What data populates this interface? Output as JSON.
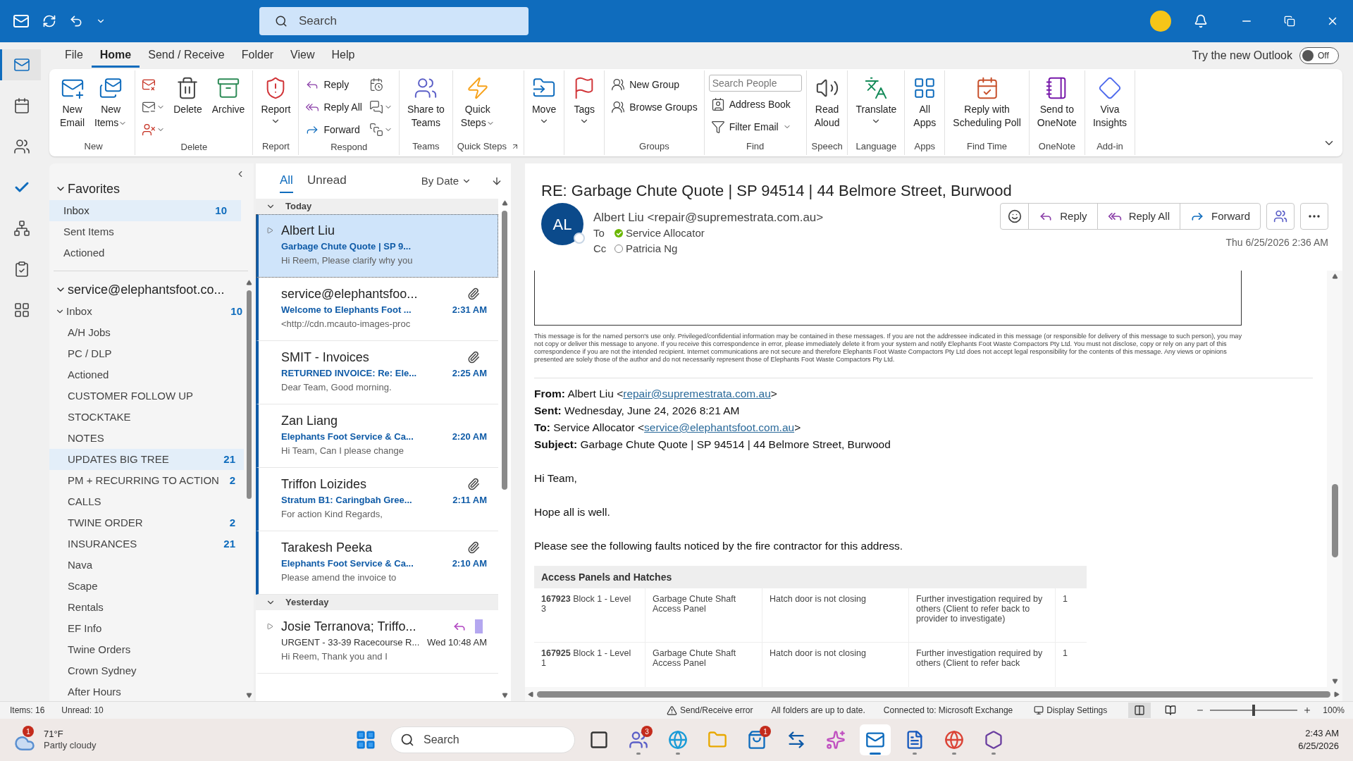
{
  "title_bar": {
    "search": {
      "placeholder": "Search"
    }
  },
  "app_rail": [
    {
      "selected": true
    },
    {
      "selected": false
    },
    {
      "selected": false
    },
    {
      "selected": false
    },
    {
      "selected": false
    },
    {
      "selected": false
    },
    {
      "selected": false
    }
  ],
  "menu_tabs": [
    {
      "label": "File",
      "selected": false
    },
    {
      "label": "Home",
      "selected": true
    },
    {
      "label": "Send / Receive",
      "selected": false
    },
    {
      "label": "Folder",
      "selected": false
    },
    {
      "label": "View",
      "selected": false
    },
    {
      "label": "Help",
      "selected": false
    }
  ],
  "new_outlook": {
    "label": "Try the new Outlook",
    "switch_label": "Off",
    "on": false
  },
  "ribbon": {
    "groups": [
      {
        "label": "New",
        "items": [
          {
            "kind": "large",
            "lines": [
              "New",
              "Email"
            ]
          },
          {
            "kind": "large",
            "lines": [
              "New",
              "Items"
            ],
            "dropdown": true
          }
        ]
      },
      {
        "label": "Delete",
        "items": [
          {
            "kind": "icon"
          },
          {
            "kind": "icon",
            "dropdown": true
          },
          {
            "kind": "icon",
            "dropdown": true
          },
          {
            "kind": "large",
            "lines": [
              "Delete"
            ]
          },
          {
            "kind": "large",
            "lines": [
              "Archive"
            ]
          }
        ]
      },
      {
        "label": "Report",
        "items": [
          {
            "kind": "large",
            "lines": [
              "Report"
            ],
            "dropdown": true
          }
        ]
      },
      {
        "label": "Respond",
        "items": [
          {
            "kind": "small",
            "label": "Reply"
          },
          {
            "kind": "small",
            "label": "Reply All"
          },
          {
            "kind": "small",
            "label": "Forward"
          },
          {
            "kind": "icon"
          },
          {
            "kind": "icon",
            "dropdown": true
          },
          {
            "kind": "icon",
            "dropdown": true
          }
        ]
      },
      {
        "label": "Teams",
        "items": [
          {
            "kind": "large",
            "lines": [
              "Share to",
              "Teams"
            ]
          }
        ]
      },
      {
        "label": "Quick Steps",
        "launcher": true,
        "items": [
          {
            "kind": "large",
            "lines": [
              "Quick",
              "Steps"
            ],
            "dropdown": true
          }
        ]
      },
      {
        "items": [
          {
            "kind": "large",
            "lines": [
              "Move"
            ],
            "dropdown": true
          }
        ]
      },
      {
        "items": [
          {
            "kind": "large",
            "lines": [
              "Tags"
            ],
            "dropdown": true
          }
        ]
      },
      {
        "label": "Groups",
        "items": [
          {
            "kind": "small",
            "label": "New Group"
          },
          {
            "kind": "small",
            "label": "Browse Groups"
          }
        ]
      },
      {
        "label": "Find",
        "items": [
          {
            "kind": "field",
            "placeholder": "Search People"
          },
          {
            "kind": "small",
            "label": "Address Book"
          },
          {
            "kind": "small",
            "label": "Filter Email",
            "dropdown": true
          }
        ]
      },
      {
        "label": "Speech",
        "items": [
          {
            "kind": "large",
            "lines": [
              "Read",
              "Aloud"
            ]
          }
        ]
      },
      {
        "label": "Language",
        "items": [
          {
            "kind": "large",
            "lines": [
              "Translate"
            ],
            "dropdown": true
          }
        ]
      },
      {
        "label": "Apps",
        "items": [
          {
            "kind": "large",
            "lines": [
              "All",
              "Apps"
            ]
          }
        ]
      },
      {
        "label": "Find Time",
        "items": [
          {
            "kind": "large",
            "lines": [
              "Reply with",
              "Scheduling Poll"
            ]
          }
        ]
      },
      {
        "label": "OneNote",
        "items": [
          {
            "kind": "large",
            "lines": [
              "Send to",
              "OneNote"
            ]
          }
        ]
      },
      {
        "label": "Add-in",
        "items": [
          {
            "kind": "large",
            "lines": [
              "Viva",
              "Insights"
            ]
          }
        ]
      }
    ]
  },
  "folder_pane": {
    "favorites": {
      "label": "Favorites",
      "expanded": true,
      "items": [
        {
          "name": "Inbox",
          "count": "10",
          "selected": true
        },
        {
          "name": "Sent Items",
          "selected": false
        },
        {
          "name": "Actioned",
          "selected": false
        }
      ]
    },
    "account": {
      "label": "service@elephantsfoot.co...",
      "expanded": true,
      "folders": [
        {
          "name": "Inbox",
          "count": "10",
          "expanded": true,
          "selected": false,
          "children": [
            {
              "name": "A/H Jobs",
              "selected": false
            },
            {
              "name": "PC / DLP",
              "selected": false
            },
            {
              "name": "Actioned",
              "selected": false
            },
            {
              "name": "CUSTOMER FOLLOW UP",
              "selected": false
            },
            {
              "name": "STOCKTAKE",
              "selected": false
            },
            {
              "name": "NOTES",
              "selected": false
            },
            {
              "name": "UPDATES BIG TREE",
              "count": "21",
              "selected": true
            },
            {
              "name": "PM + RECURRING TO ACTION",
              "count": "2",
              "selected": false
            },
            {
              "name": "CALLS",
              "selected": false
            },
            {
              "name": "TWINE ORDER",
              "count": "2",
              "selected": false
            },
            {
              "name": "INSURANCES",
              "count": "21",
              "selected": false
            },
            {
              "name": "Nava",
              "selected": false
            },
            {
              "name": "Scape",
              "selected": false
            },
            {
              "name": "Rentals",
              "selected": false
            },
            {
              "name": "EF Info",
              "selected": false
            },
            {
              "name": "Twine Orders",
              "selected": false
            },
            {
              "name": "Crown Sydney",
              "selected": false
            },
            {
              "name": "After Hours",
              "selected": false
            }
          ]
        }
      ]
    }
  },
  "message_list": {
    "filters": [
      {
        "label": "All",
        "selected": true
      },
      {
        "label": "Unread",
        "selected": false
      }
    ],
    "sort": "By Date",
    "groups": [
      {
        "label": "Today",
        "expanded": true,
        "messages": [
          {
            "sender": "Albert Liu",
            "subject": "Garbage Chute Quote | SP 9...",
            "preview": "Hi Reem,  Please clarify why you",
            "thread": true,
            "unread": true,
            "selected": true,
            "attachment": false
          },
          {
            "sender": "service@elephantsfoo...",
            "subject": "Welcome to Elephants Foot ...",
            "preview": "<http://cdn.mcauto-images-proc",
            "time": "2:31 AM",
            "thread": false,
            "unread": true,
            "selected": false,
            "attachment": true
          },
          {
            "sender": "SMIT - Invoices",
            "subject": "RETURNED INVOICE: Re: Ele...",
            "preview": "Dear Team,  Good morning.",
            "time": "2:25 AM",
            "thread": false,
            "unread": true,
            "selected": false,
            "attachment": true
          },
          {
            "sender": "Zan Liang",
            "subject": "Elephants Foot Service & Ca...",
            "preview": "Hi Team,  Can I please change",
            "time": "2:20 AM",
            "thread": false,
            "unread": true,
            "selected": false,
            "attachment": false
          },
          {
            "sender": "Triffon Loizides",
            "subject": "Stratum B1: Caringbah Gree...",
            "preview": "For action  Kind Regards,",
            "time": "2:11 AM",
            "thread": false,
            "unread": true,
            "selected": false,
            "attachment": true
          },
          {
            "sender": "Tarakesh Peeka",
            "subject": "Elephants Foot Service & Ca...",
            "preview": "Please amend the invoice to",
            "time": "2:10 AM",
            "thread": false,
            "unread": true,
            "selected": false,
            "attachment": true
          }
        ]
      },
      {
        "label": "Yesterday",
        "expanded": true,
        "messages": [
          {
            "sender": "Josie Terranova;  Triffo...",
            "subject": "URGENT - 33-39 Racecourse R...",
            "preview": "Hi Reem,  Thank you and I",
            "time": "Wed 10:48 AM",
            "thread": true,
            "unread": false,
            "selected": false,
            "attachment": false,
            "replied": true,
            "color": "#b4a7f0"
          }
        ]
      }
    ]
  },
  "reading_pane": {
    "subject": "RE: Garbage Chute Quote | SP 94514 | 44 Belmore Street, Burwood",
    "initials": "AL",
    "from": "Albert Liu <repair@supremestrata.com.au>",
    "to_label": "To",
    "to": "Service Allocator",
    "to_available": true,
    "cc_label": "Cc",
    "cc": "Patricia Ng",
    "cc_available": false,
    "actions": [
      {
        "kind": "reply",
        "label": "Reply"
      },
      {
        "kind": "reply_all",
        "label": "Reply All"
      },
      {
        "kind": "forward",
        "label": "Forward"
      }
    ],
    "date": "Thu 6/25/2026 2:36 AM",
    "disclaimer": "This message is for the named person's use only. Privileged/confidential information may be contained in these messages. If you are not the addressee indicated in this message (or responsible for delivery of this message to such person), you may not copy or deliver this message to anyone. If you receive this correspondence in error, please immediately delete it from your system and notify Elephants Foot Waste Compactors Pty Ltd. You must not disclose, copy or rely on any part of this correspondence if you are not the intended recipient. Internet communications are not secure and therefore Elephants Foot Waste Compactors Pty Ltd does not accept legal responsibility for the contents of this message. Any views or opinions presented are solely those of the author and do not necessarily represent those of Elephants Foot Waste Compactors Pty Ltd.",
    "quoted_header": [
      {
        "label": "From:",
        "text": "Albert Liu <",
        "link": "repair@supremestrata.com.au",
        "suffix": ">"
      },
      {
        "label": "Sent:",
        "text": "Wednesday, June 24, 2026 8:21 AM"
      },
      {
        "label": "To:",
        "text": "Service Allocator <",
        "link": "service@elephantsfoot.com.au",
        "suffix": ">"
      },
      {
        "label": "Subject:",
        "text": "Garbage Chute Quote | SP 94514 | 44 Belmore Street, Burwood"
      }
    ],
    "paragraphs": [
      "Hi Team,",
      "Hope all is well.",
      "Please see the following faults noticed by the fire contractor for this address."
    ],
    "table": {
      "title": "Access Panels and Hatches",
      "rows": [
        [
          "**167923** Block 1 - Level 3",
          "Garbage Chute Shaft Access Panel",
          "Hatch door is not closing",
          "Further investigation required by others (Client to refer back to provider to investigate)",
          "1"
        ],
        [
          "**167925** Block 1 - Level 1",
          "Garbage Chute Shaft Access Panel",
          "Hatch door is not closing",
          "Further investigation required by others (Client to refer back",
          "1"
        ]
      ]
    }
  },
  "status_bar": {
    "items": "Items: 16",
    "unread": "Unread: 10",
    "error": "Send/Receive error",
    "sync": "All folders are up to date.",
    "connection": "Connected to: Microsoft Exchange",
    "display_settings": "Display Settings",
    "views": [
      {
        "selected": true
      },
      {
        "selected": false
      }
    ],
    "zoom": {
      "level": 0.5,
      "reading": "100%"
    }
  },
  "taskbar": {
    "weather": {
      "badge": "1",
      "temperature": "71°F",
      "condition": "Partly cloudy"
    },
    "search": {
      "placeholder": "Search"
    },
    "apps": [
      {
        "running": false,
        "selected": false
      },
      {
        "badge": "3",
        "running": true,
        "selected": false
      },
      {
        "running": true,
        "selected": false
      },
      {
        "running": false,
        "selected": false
      },
      {
        "badge": "1",
        "running": false,
        "selected": false
      },
      {
        "running": false,
        "selected": false
      },
      {
        "running": false,
        "selected": false
      },
      {
        "running": true,
        "selected": true
      },
      {
        "running": true,
        "selected": false
      },
      {
        "running": true,
        "selected": false
      },
      {
        "running": true,
        "selected": false
      }
    ],
    "clock": {
      "time": "2:43 AM",
      "date": "6/25/2026"
    }
  }
}
